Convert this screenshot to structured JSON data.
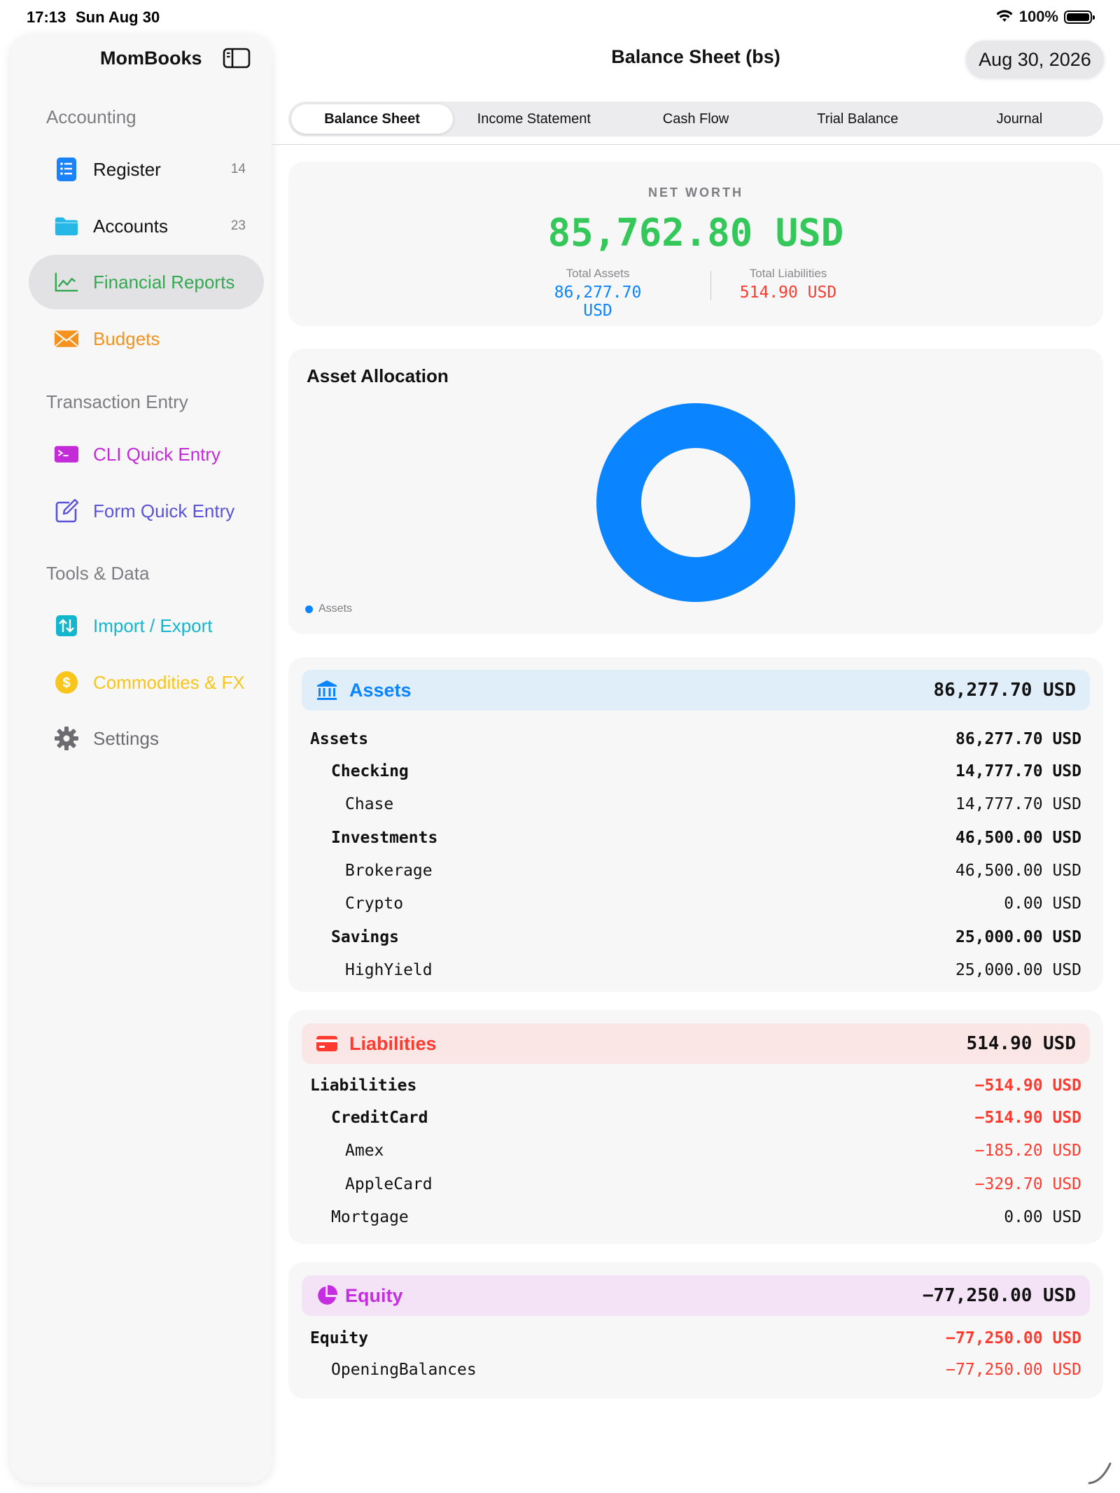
{
  "status": {
    "time": "17:13",
    "date": "Sun Aug 30",
    "battery": "100%"
  },
  "sidebar": {
    "app_name": "MomBooks",
    "sections": [
      {
        "header": "Accounting"
      },
      {
        "header": "Transaction Entry"
      },
      {
        "header": "Tools & Data"
      }
    ],
    "items": [
      {
        "label": "Register",
        "count": "14",
        "icon": "list-icon",
        "color": "#1a82fb"
      },
      {
        "label": "Accounts",
        "count": "23",
        "icon": "folder-icon",
        "color": "#25b8e6"
      },
      {
        "label": "Financial Reports",
        "icon": "chart-line-icon",
        "color": "#34a853"
      },
      {
        "label": "Budgets",
        "icon": "envelope-icon",
        "color": "#f5921e"
      },
      {
        "label": "CLI Quick Entry",
        "icon": "terminal-icon",
        "color": "#c32ad8"
      },
      {
        "label": "Form Quick Entry",
        "icon": "compose-icon",
        "color": "#5a52d8"
      },
      {
        "label": "Import / Export",
        "icon": "arrows-updown-icon",
        "color": "#13b6cc"
      },
      {
        "label": "Commodities & FX",
        "icon": "dollar-coin-icon",
        "color": "#f7c51c"
      },
      {
        "label": "Settings",
        "icon": "gear-icon",
        "color": "#6c6c70"
      }
    ],
    "active_item": "Financial Reports"
  },
  "header": {
    "title": "Balance Sheet (bs)",
    "date": "Aug 30, 2026"
  },
  "tabs": [
    "Balance Sheet",
    "Income Statement",
    "Cash Flow",
    "Trial Balance",
    "Journal"
  ],
  "active_tab": "Balance Sheet",
  "net_worth": {
    "label": "NET WORTH",
    "value": "85,762.80 USD",
    "total_assets_label": "Total Assets",
    "total_assets": "86,277.70 USD",
    "total_liabilities_label": "Total Liabilities",
    "total_liabilities": "514.90 USD"
  },
  "allocation": {
    "title": "Asset Allocation",
    "legend": "Assets",
    "color": "#0a84ff"
  },
  "chart_data": {
    "type": "pie",
    "categories": [
      "Assets"
    ],
    "values": [
      86277.7
    ],
    "title": "Asset Allocation",
    "legend": [
      "Assets"
    ]
  },
  "sections": {
    "assets": {
      "name": "Assets",
      "total": "86,277.70 USD",
      "rows": [
        {
          "name": "Assets",
          "amount": "86,277.70 USD",
          "level": 0,
          "bold": true
        },
        {
          "name": "Checking",
          "amount": "14,777.70 USD",
          "level": 1,
          "bold": true
        },
        {
          "name": "Chase",
          "amount": "14,777.70 USD",
          "level": 2,
          "bold": false
        },
        {
          "name": "Investments",
          "amount": "46,500.00 USD",
          "level": 1,
          "bold": true
        },
        {
          "name": "Brokerage",
          "amount": "46,500.00 USD",
          "level": 2,
          "bold": false
        },
        {
          "name": "Crypto",
          "amount": "0.00 USD",
          "level": 2,
          "bold": false
        },
        {
          "name": "Savings",
          "amount": "25,000.00 USD",
          "level": 1,
          "bold": true
        },
        {
          "name": "HighYield",
          "amount": "25,000.00 USD",
          "level": 2,
          "bold": false
        }
      ]
    },
    "liabilities": {
      "name": "Liabilities",
      "total": "514.90 USD",
      "rows": [
        {
          "name": "Liabilities",
          "amount": "−514.90 USD",
          "level": 0,
          "bold": true,
          "negative": true
        },
        {
          "name": "CreditCard",
          "amount": "−514.90 USD",
          "level": 1,
          "bold": true,
          "negative": true
        },
        {
          "name": "Amex",
          "amount": "−185.20 USD",
          "level": 2,
          "bold": false,
          "negative": true
        },
        {
          "name": "AppleCard",
          "amount": "−329.70 USD",
          "level": 2,
          "bold": false,
          "negative": true
        },
        {
          "name": "Mortgage",
          "amount": "0.00 USD",
          "level": 1,
          "bold": false
        }
      ]
    },
    "equity": {
      "name": "Equity",
      "total": "−77,250.00 USD",
      "rows": [
        {
          "name": "Equity",
          "amount": "−77,250.00 USD",
          "level": 0,
          "bold": true,
          "negative": true
        },
        {
          "name": "OpeningBalances",
          "amount": "−77,250.00 USD",
          "level": 1,
          "bold": false,
          "negative": true
        }
      ]
    }
  },
  "colors": {
    "assets": "#0a84ff",
    "assets_bg": "#e0eefa",
    "liabilities": "#ff3b30",
    "liabilities_bg": "#fbe6e6",
    "equity": "#c42ee0",
    "equity_bg": "#f4e3f6",
    "positive": "#34c759"
  }
}
